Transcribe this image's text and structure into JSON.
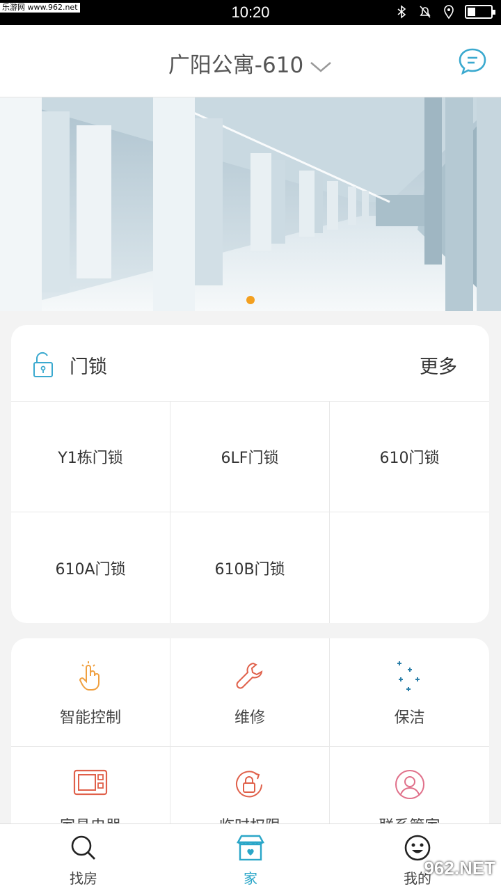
{
  "status_bar": {
    "watermark": "乐游网 www.962.net",
    "time": "10:20",
    "battery_level": 0.3
  },
  "header": {
    "title": "广阳公寓-610"
  },
  "banner": {
    "active_slide": 1,
    "slide_count": 1
  },
  "lock_card": {
    "title": "门锁",
    "more_label": "更多",
    "locks": [
      "Y1栋门锁",
      "6LF门锁",
      "610门锁",
      "610A门锁",
      "610B门锁"
    ]
  },
  "services": [
    {
      "label": "智能控制",
      "icon": "tap-hand-icon"
    },
    {
      "label": "维修",
      "icon": "wrench-icon"
    },
    {
      "label": "保洁",
      "icon": "sparkle-icon"
    },
    {
      "label": "家具电器",
      "icon": "microwave-icon"
    },
    {
      "label": "临时权限",
      "icon": "rotate-lock-icon"
    },
    {
      "label": "联系管家",
      "icon": "person-icon"
    }
  ],
  "bottom_nav": [
    {
      "label": "找房",
      "icon": "search-icon",
      "active": false
    },
    {
      "label": "家",
      "icon": "home-icon",
      "active": true
    },
    {
      "label": "我的",
      "icon": "smile-icon",
      "active": false
    }
  ],
  "bottom_watermark": "962.NET",
  "colors": {
    "accent": "#2aa6c8",
    "orange": "#f3a020",
    "red_icon": "#e0604a"
  }
}
